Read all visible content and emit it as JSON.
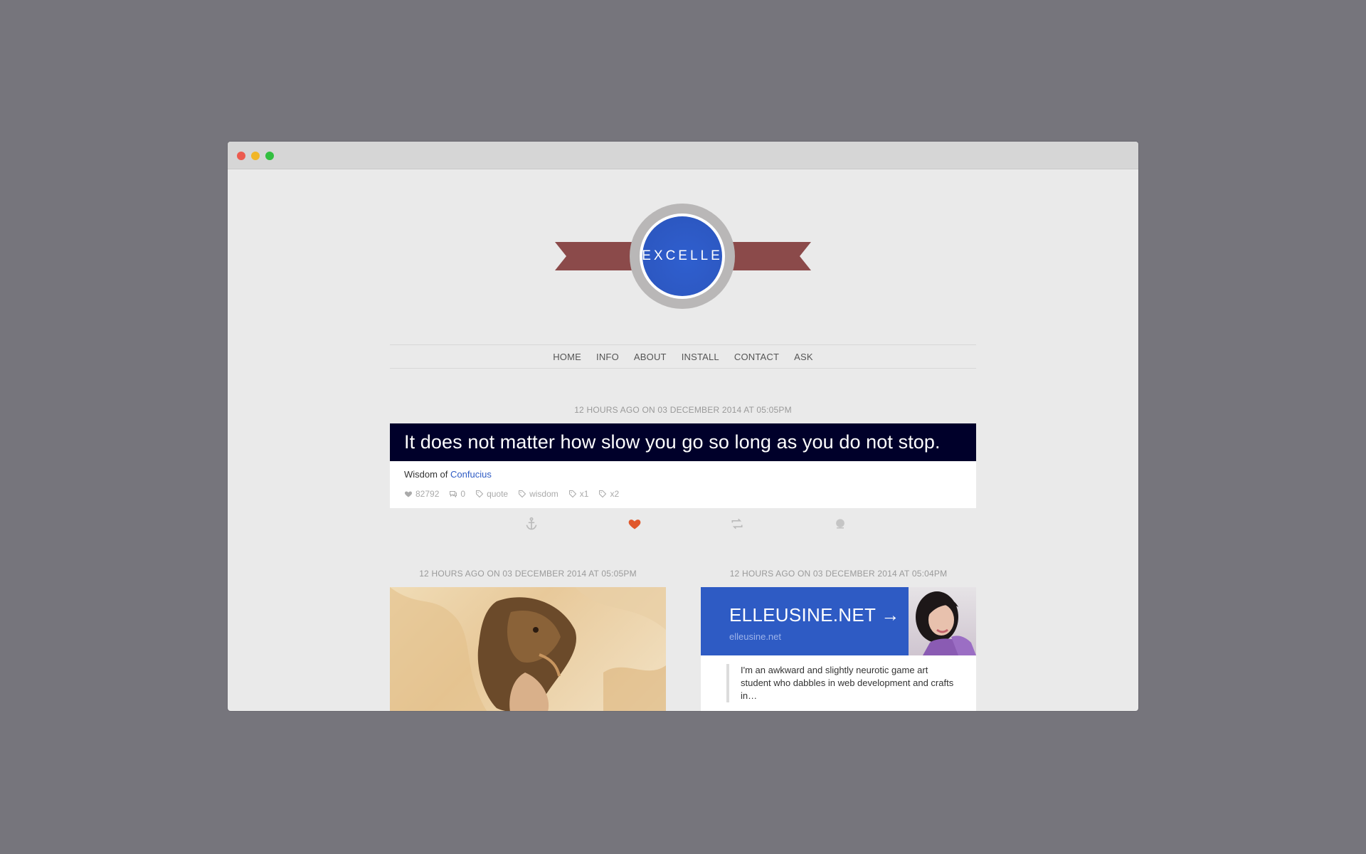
{
  "logo": {
    "text": "EXCELLE",
    "colors": {
      "ribbon": "#8b4a4a",
      "badge": "#2d59c4"
    }
  },
  "nav": {
    "items": [
      "HOME",
      "INFO",
      "ABOUT",
      "INSTALL",
      "CONTACT",
      "ASK"
    ]
  },
  "posts": {
    "quote": {
      "timestamp": "12 HOURS AGO ON 03 DECEMBER 2014 AT 05:05PM",
      "text": "It does not matter how slow you go so long as you do not stop.",
      "source_prefix": "Wisdom of",
      "source_link": "Confucius",
      "likes": "82792",
      "comments": "0",
      "tags": [
        "quote",
        "wisdom",
        "x1",
        "x2"
      ]
    },
    "photo": {
      "timestamp": "12 HOURS AGO ON 03 DECEMBER 2014 AT 05:05PM"
    },
    "link": {
      "timestamp": "12 HOURS AGO ON 03 DECEMBER 2014 AT 05:04PM",
      "title": "ELLEUSINE.NET →",
      "url": "elleusine.net",
      "excerpt": "I'm an awkward and slightly neurotic game art student who dabbles in web development and crafts in…"
    }
  },
  "icons": {
    "like": "heart-icon",
    "comment": "comment-icon",
    "tag": "tag-icon",
    "permalink": "anchor-icon",
    "reblog": "reblog-icon",
    "share": "globe-icon"
  },
  "colors": {
    "accent": "#2e5bc4",
    "like_active": "#e0582c",
    "quote_bg": "#00002a"
  }
}
